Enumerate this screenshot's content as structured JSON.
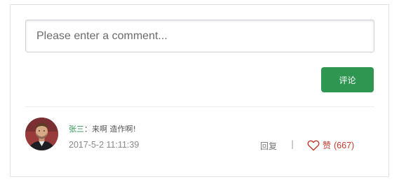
{
  "comment_form": {
    "placeholder": "Please enter a comment...",
    "value": "",
    "submit_label": "评论"
  },
  "comment": {
    "author": "张三",
    "separator": "：",
    "text": "来啊 造作啊!",
    "timestamp": "2017-5-2 11:11:39",
    "reply_label": "回复",
    "action_separator": "|",
    "like_label": "赞",
    "like_count": "(667)",
    "avatar_icon": "user-avatar-photo"
  },
  "colors": {
    "accent": "#2f9651",
    "like": "#c0392b"
  }
}
